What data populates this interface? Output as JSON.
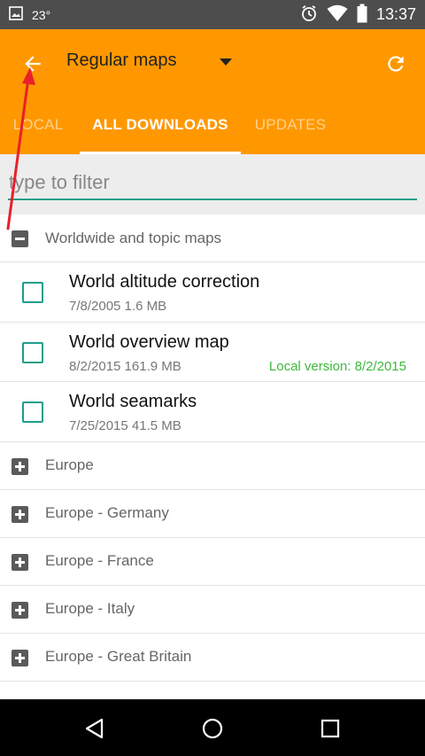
{
  "status_bar": {
    "temperature": "23°",
    "time": "13:37",
    "icons": [
      "image-icon",
      "alarm-icon",
      "wifi-icon",
      "battery-icon"
    ]
  },
  "app_bar": {
    "title": "Regular maps",
    "background_color": "#ff9800",
    "icons": [
      "back-arrow-icon",
      "dropdown-caret-icon",
      "refresh-icon"
    ]
  },
  "tabs": [
    {
      "label": "LOCAL",
      "selected": false
    },
    {
      "label": "ALL DOWNLOADS",
      "selected": true
    },
    {
      "label": "UPDATES",
      "selected": false
    }
  ],
  "filter": {
    "placeholder": "type to filter",
    "value": "",
    "accent_color": "#1e9e8a"
  },
  "list": {
    "expanded_group": {
      "label": "Worldwide and topic maps",
      "state": "collapse-icon",
      "items": [
        {
          "name": "World altitude correction",
          "meta": "7/8/2005 1.6 MB",
          "local": ""
        },
        {
          "name": "World overview map",
          "meta": "8/2/2015 161.9 MB",
          "local": "Local version: 8/2/2015"
        },
        {
          "name": "World seamarks",
          "meta": "7/25/2015 41.5 MB",
          "local": ""
        }
      ]
    },
    "collapsed_groups": [
      {
        "label": "Europe"
      },
      {
        "label": "Europe - Germany"
      },
      {
        "label": "Europe - France"
      },
      {
        "label": "Europe - Italy"
      },
      {
        "label": "Europe - Great Britain"
      }
    ]
  },
  "nav_bar": {
    "icons": [
      "nav-back-icon",
      "nav-home-icon",
      "nav-recent-icon"
    ]
  },
  "colors": {
    "status_bar": "#4d4d4d",
    "local_version": "#3cb93c",
    "annotation_arrow": "#e8202a"
  }
}
